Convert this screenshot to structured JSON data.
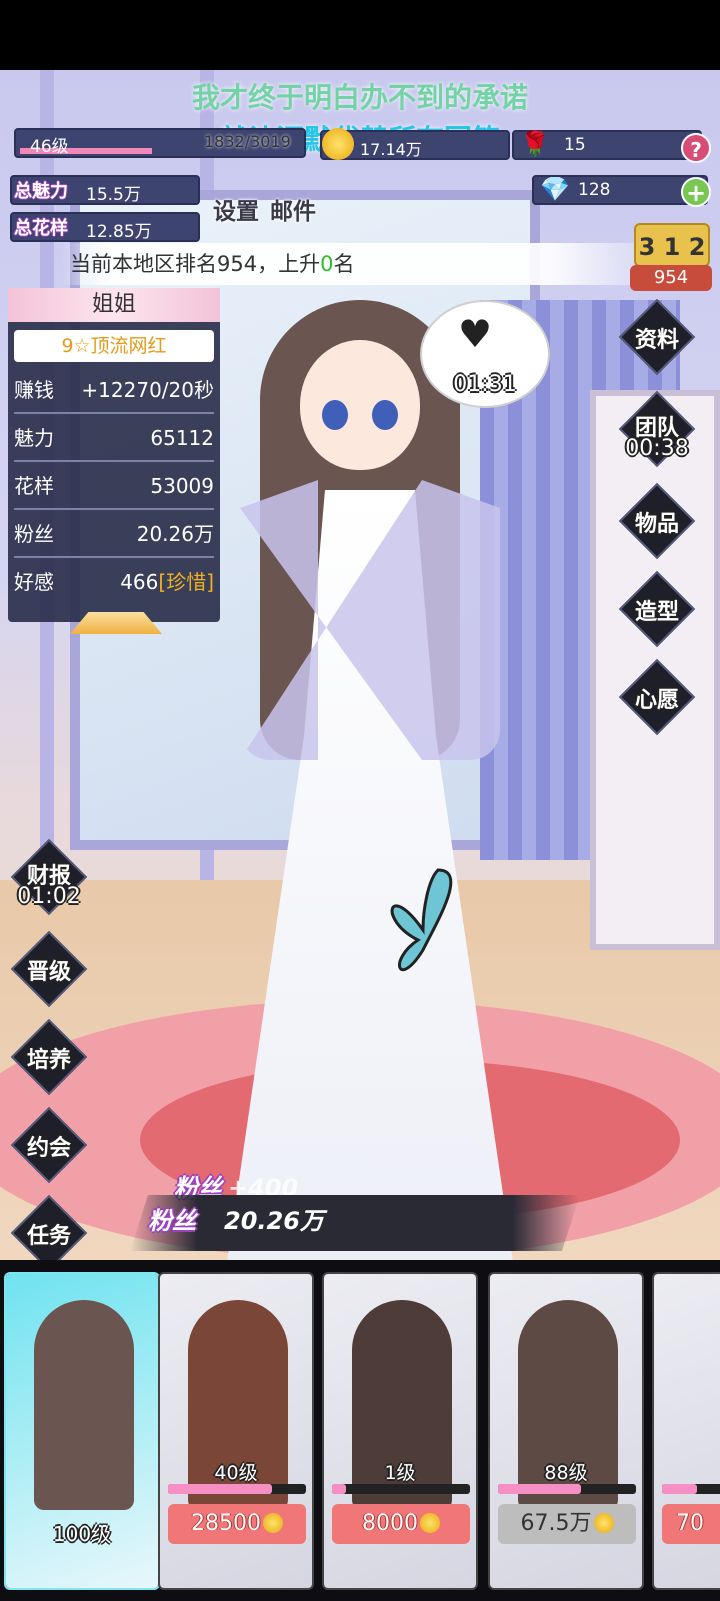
{
  "lyrics": {
    "line1": "我才终于明白办不到的承诺",
    "line2": "就让沉默代替所有回答"
  },
  "status": {
    "level": "46级",
    "xp": "1832/3019",
    "gold": "17.14万",
    "roses": "15",
    "gems": "128",
    "help": "?",
    "plus": "+",
    "total_charm_label": "总魅力",
    "total_charm": "15.5万",
    "total_style_label": "总花样",
    "total_style": "12.85万"
  },
  "menu": {
    "settings": "设置",
    "mail": "邮件"
  },
  "rank": {
    "prefix": "当前本地区排名954，上升",
    "change": "0",
    "suffix": "名",
    "podium": "3 1 2",
    "value": "954"
  },
  "panel": {
    "name": "姐姐",
    "title": "9☆顶流网红",
    "rows": [
      {
        "label": "赚钱",
        "value": "+12270/20秒"
      },
      {
        "label": "魅力",
        "value": "65112"
      },
      {
        "label": "花样",
        "value": "53009"
      },
      {
        "label": "粉丝",
        "value": "20.26万"
      },
      {
        "label": "好感",
        "value": "466",
        "tag": "[珍惜]"
      }
    ]
  },
  "right_buttons": [
    {
      "label": "资料"
    },
    {
      "label": "团队",
      "timer": "00:38"
    },
    {
      "label": "物品"
    },
    {
      "label": "造型"
    },
    {
      "label": "心愿"
    }
  ],
  "left_buttons": [
    {
      "label": "财报",
      "timer": "01:02"
    },
    {
      "label": "晋级"
    },
    {
      "label": "培养"
    },
    {
      "label": "约会"
    },
    {
      "label": "任务"
    }
  ],
  "bubble": {
    "timer": "01:31"
  },
  "fans": {
    "label": "粉丝",
    "gain": "+400",
    "total": "20.26万"
  },
  "cards": [
    {
      "level": "100级"
    },
    {
      "level": "40级",
      "price": "28500",
      "progress": 0.75
    },
    {
      "level": "1级",
      "price": "8000",
      "progress": 0.1
    },
    {
      "level": "88级",
      "price": "67.5万",
      "progress": 0.6
    },
    {
      "price": "70"
    }
  ],
  "colors": {
    "accent_pink": "#f288b8",
    "price_red": "#f07678",
    "gold": "#e8a810"
  }
}
